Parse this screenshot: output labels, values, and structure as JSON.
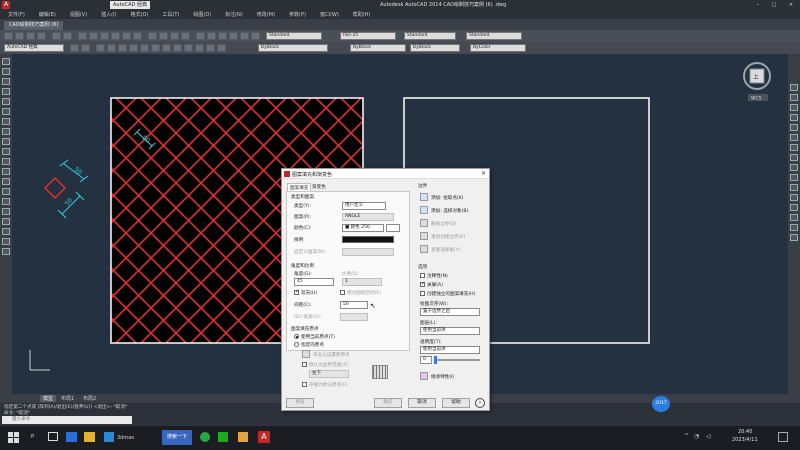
{
  "titlebar": {
    "qa_label": "AutoCAD 经典",
    "title": "Autodesk AutoCAD 2014    CAD绘制技巧案例 (6) .dwg"
  },
  "menubar": {
    "items": [
      "文件(F)",
      "编辑(E)",
      "视图(V)",
      "插入(I)",
      "格式(O)",
      "工具(T)",
      "绘图(D)",
      "标注(N)",
      "修改(M)",
      "参数(P)",
      "窗口(W)",
      "帮助(H)"
    ]
  },
  "file_tab": {
    "label": "CAD绘制技巧案例 (6)"
  },
  "toolbar": {
    "workspace": "AutoCAD 经典",
    "style1": "Standard",
    "style2": "ISO-25",
    "style3": "Standard",
    "style4": "Standard",
    "layer1": "ByBlock",
    "layer2": "ByBlock",
    "layer3": "ByBlock",
    "layer4": "ByColor"
  },
  "canvas": {
    "dim1": "50",
    "dim2": "50",
    "dim3": "50",
    "viewcube": "上",
    "wcs": "WCS",
    "colors": {
      "hatch": "#e03030",
      "dim": "#35d0e0",
      "frame": "#ffffff",
      "bg": "#243140"
    }
  },
  "layout_tabs": [
    "模型",
    "布局1",
    "布局2"
  ],
  "command": {
    "line1": "指定第二个点或 [阵列(A)/退出(E)/放弃(U)] <退出>: *取消*",
    "line2": "命令: *取消*",
    "prompt": "键入命令"
  },
  "dialog": {
    "title": "图案填充和渐变色",
    "tabs": [
      "图案填充",
      "渐变色"
    ],
    "type_pattern": "类型和图案",
    "type_label": "类型(Y):",
    "type_value": "用户定义",
    "pattern_label": "图案(P):",
    "pattern_value": "ANGLE",
    "color_label": "颜色(C):",
    "color_value": "■ 颜色 250",
    "swatch_label": "样例:",
    "custom_label": "自定义图案(M):",
    "angle_scale": "角度和比例",
    "angle_label": "角度(G):",
    "angle_value": "45",
    "scale_label": "比例(S):",
    "scale_value": "1",
    "double_label": "双向(U)",
    "relative_label": "相对图纸空间(E)",
    "spacing_label": "间距(C):",
    "spacing_value": "50",
    "iso_label": "ISO 笔宽(O):",
    "origin_group": "图案填充原点",
    "use_current": "使用当前原点(T)",
    "specified": "指定的原点",
    "click_set": "单击以设置新原点",
    "default_ext": "默认为边界范围(X)",
    "lower_left": "左下",
    "store_default": "存储为默认原点(F)",
    "border_group": "边界",
    "add_pick": "添加: 拾取点(K)",
    "add_select": "添加: 选择对象(B)",
    "remove_border": "删除边界(D)",
    "recreate_border": "重新创建边界(R)",
    "view_select": "查看选择集(V)",
    "options_group": "选项",
    "annotative": "注释性(N)",
    "associative": "关联(A)",
    "separate": "创建独立的图案填充(H)",
    "draw_order_label": "绘图次序(W):",
    "draw_order_value": "置于边界之后",
    "layer_label": "图层(L):",
    "layer_value": "使用当前项",
    "transparency_label": "透明度(T):",
    "transparency_value": "使用当前项",
    "transparency_num": "0",
    "inherit": "继承特性(I)",
    "preview_btn": "预览",
    "ok_btn": "确定",
    "cancel_btn": "取消",
    "help_btn": "帮助"
  },
  "taskbar": {
    "app1": "3dmax",
    "app2": "搜索一下",
    "time": "20:40",
    "date": "2023/4/11",
    "badge": "2017"
  }
}
